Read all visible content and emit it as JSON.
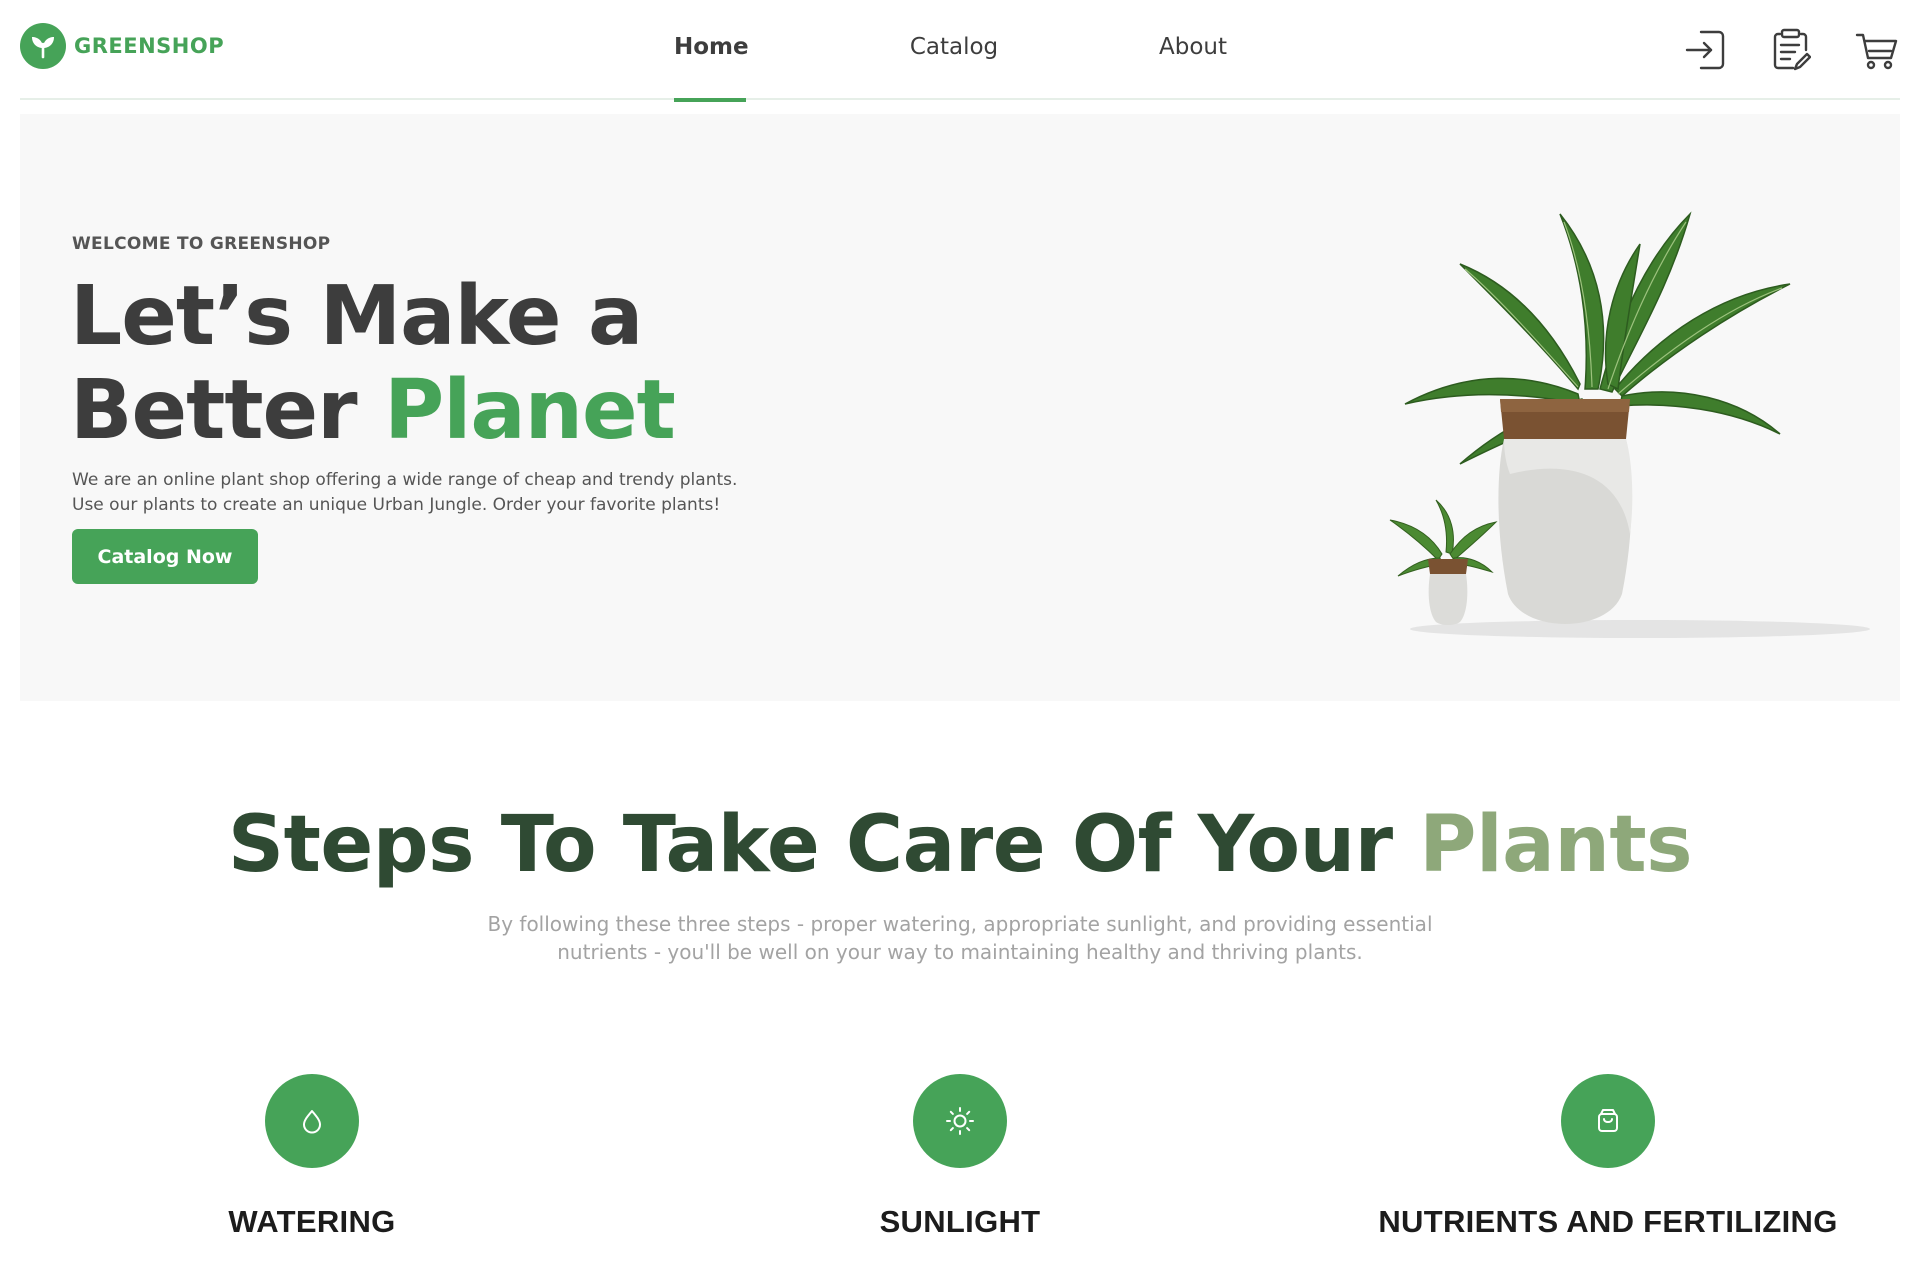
{
  "brand": {
    "name": "GREENSHOP",
    "color": "#46a358"
  },
  "nav": {
    "items": [
      {
        "label": "Home",
        "active": true
      },
      {
        "label": "Catalog",
        "active": false
      },
      {
        "label": "About",
        "active": false
      }
    ]
  },
  "header_icons": [
    "login-icon",
    "orders-icon",
    "cart-icon"
  ],
  "hero": {
    "kicker": "WELCOME TO GREENSHOP",
    "title_line1": "Let’s Make a",
    "title_line2_plain": "Better ",
    "title_line2_accent": "Planet",
    "description_line1": "We are an online plant shop offering a wide range of cheap and trendy plants.",
    "description_line2": "Use our plants to create an unique Urban Jungle. Order your favorite plants!",
    "button_label": "Catalog Now"
  },
  "steps": {
    "title_plain": "Steps To Take Care Of Your ",
    "title_accent": "Plants",
    "description_line1": "By following these three steps - proper watering, appropriate sunlight, and providing essential",
    "description_line2": "nutrients - you'll be well on your way to maintaining healthy and thriving plants.",
    "items": [
      {
        "icon": "water-drop-icon",
        "label": "WATERING"
      },
      {
        "icon": "sun-icon",
        "label": "SUNLIGHT"
      },
      {
        "icon": "bag-icon",
        "label": "NUTRIENTS AND FERTILIZING"
      }
    ]
  }
}
